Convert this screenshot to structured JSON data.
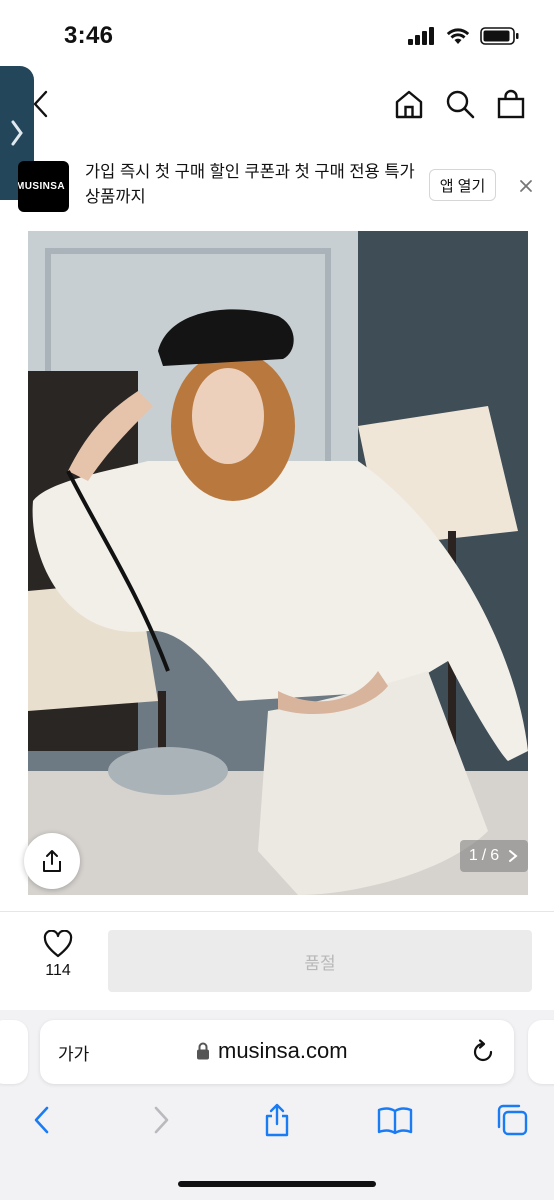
{
  "status_bar": {
    "time": "3:46"
  },
  "banner": {
    "logo_text": "MUSINSA",
    "message": "가입 즉시 첫 구매 할인 쿠폰과 첫 구매 전용 특가 상품까지",
    "open_app_label": "앱 열기"
  },
  "product": {
    "page_current": "1",
    "page_total": "6",
    "page_separator": "/",
    "like_count": "114",
    "soldout_label": "품절"
  },
  "safari": {
    "text_size_label": "가가",
    "url": "musinsa.com"
  },
  "colors": {
    "side_tab": "#23465a",
    "safari_blue": "#1a7cf5",
    "soldout_bg": "#ebebeb",
    "soldout_text": "#b8b8b8"
  },
  "icons": {
    "header": [
      "back-chevron-icon",
      "home-icon",
      "search-icon",
      "shopping-bag-icon"
    ],
    "safari_nav": [
      "back-icon",
      "forward-icon",
      "share-icon",
      "bookmarks-icon",
      "tabs-icon"
    ]
  }
}
